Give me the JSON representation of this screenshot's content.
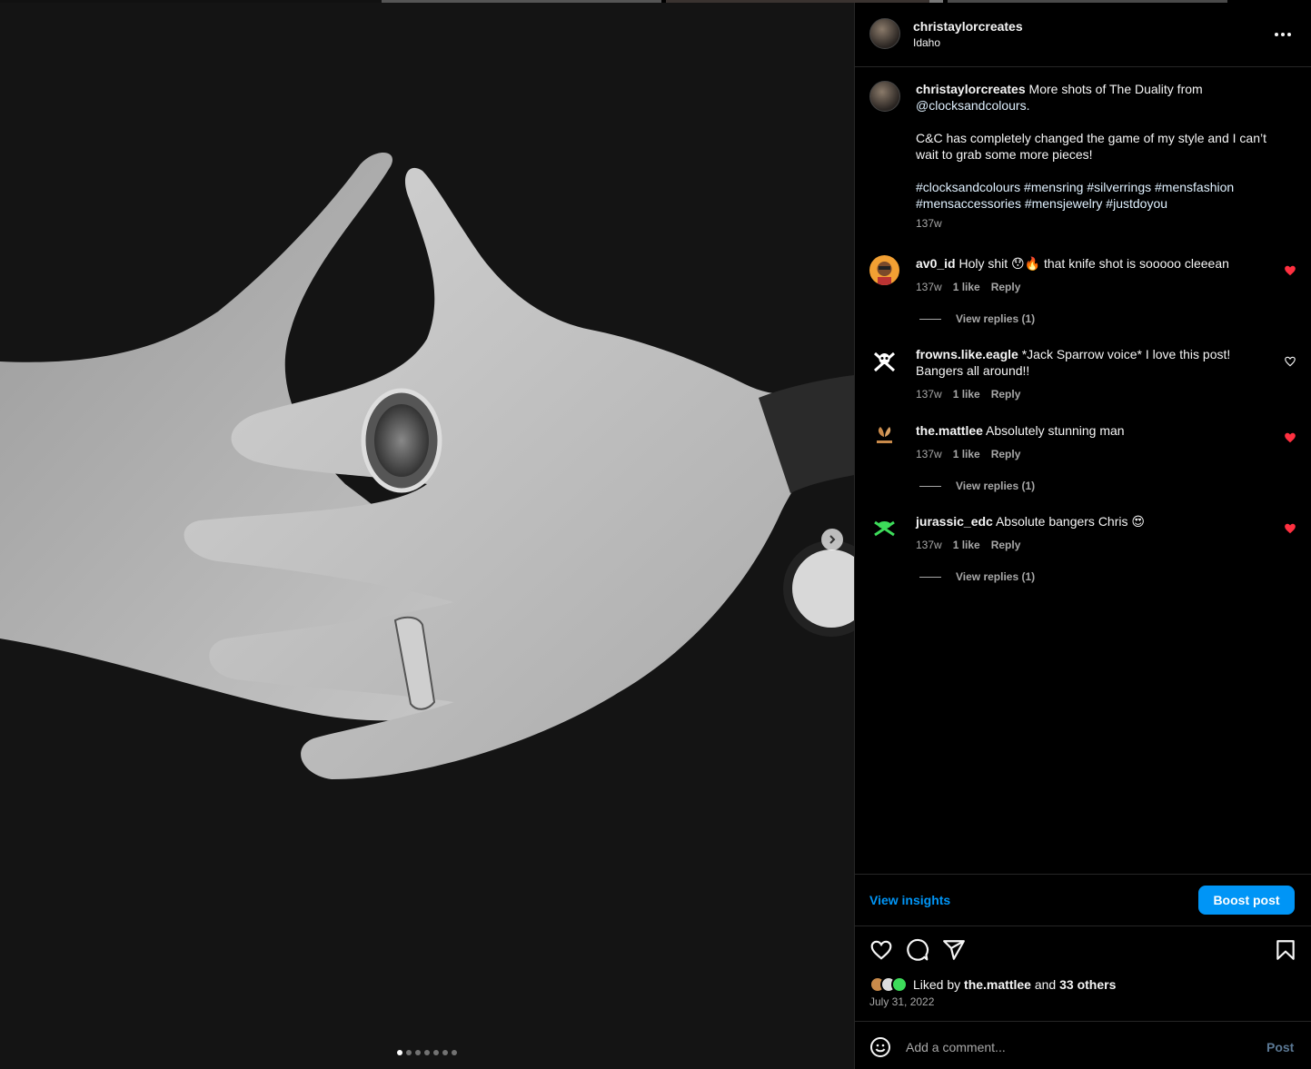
{
  "colors": {
    "accent": "#0095f6",
    "heart_red": "#ff3040",
    "muted_text": "#a8a8a8",
    "border": "#262626"
  },
  "carousel": {
    "dot_count": 7,
    "active_dot": 0
  },
  "header": {
    "username": "christaylorcreates",
    "location": "Idaho",
    "more_icon": "more-horizontal-icon"
  },
  "caption": {
    "username": "christaylorcreates",
    "text_1": "More shots of The Duality from",
    "mention": "@clocksandcolours.",
    "text_2": "C&C has completely changed the game of my style and I can’t wait to grab some more pieces!",
    "hashtags": "#clocksandcolours #mensring #silverrings #mensfashion #mensaccessories #mensjewelry #justdoyou",
    "time": "137w"
  },
  "comments": [
    {
      "username": "av0_id",
      "text": "Holy shit 😯🔥 that knife shot is sooooo cleeean",
      "time": "137w",
      "likes": "1 like",
      "reply": "Reply",
      "liked": true,
      "view_replies": "View replies (1)"
    },
    {
      "username": "frowns.like.eagle",
      "text": "*Jack Sparrow voice* I love this post! Bangers all around!!",
      "time": "137w",
      "likes": "1 like",
      "reply": "Reply",
      "liked": false,
      "view_replies": ""
    },
    {
      "username": "the.mattlee",
      "text": "Absolutely stunning man",
      "time": "137w",
      "likes": "1 like",
      "reply": "Reply",
      "liked": true,
      "view_replies": "View replies (1)"
    },
    {
      "username": "jurassic_edc",
      "text": "Absolute bangers Chris 😍",
      "time": "137w",
      "likes": "1 like",
      "reply": "Reply",
      "liked": true,
      "view_replies": "View replies (1)"
    }
  ],
  "insights": {
    "view_insights": "View insights",
    "boost_post": "Boost post"
  },
  "actions": {
    "like_icon": "heart-icon",
    "comment_icon": "comment-icon",
    "share_icon": "send-icon",
    "save_icon": "bookmark-icon"
  },
  "likes": {
    "prefix": "Liked by",
    "first_user": "the.mattlee",
    "and": "and",
    "others": "33 others"
  },
  "date": "July 31, 2022",
  "add_comment": {
    "placeholder": "Add a comment...",
    "post_label": "Post"
  }
}
